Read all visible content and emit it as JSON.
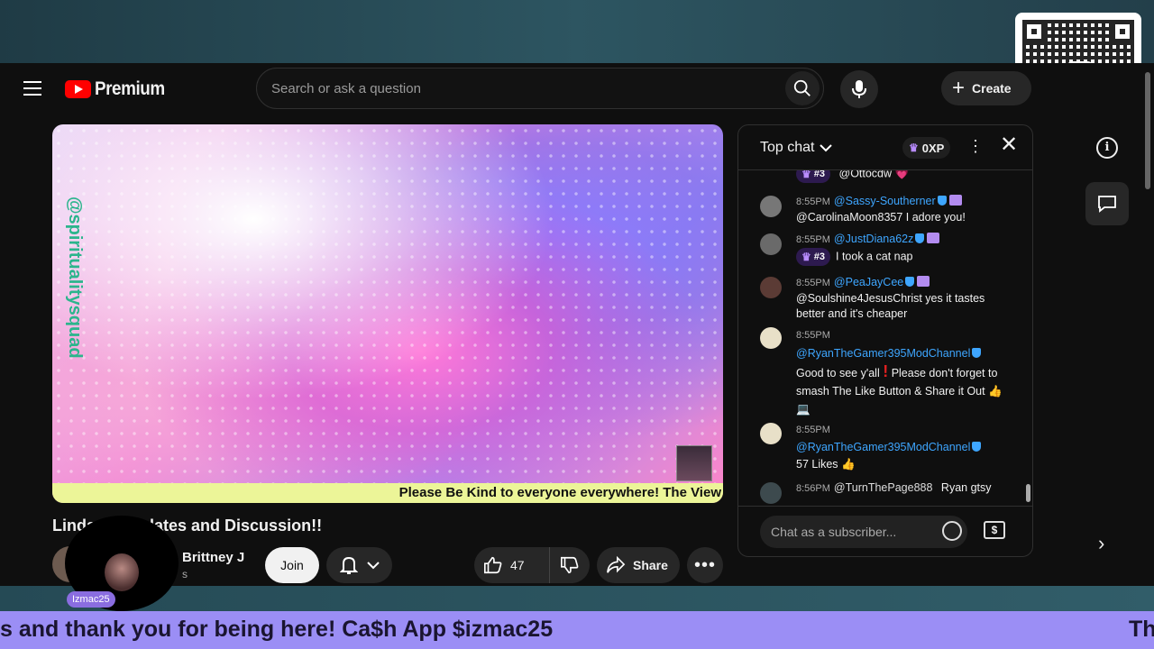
{
  "header": {
    "brand": "Premium",
    "search_placeholder": "Search or ask a question",
    "create_label": "Create"
  },
  "video": {
    "overlay_ticker": "Please Be Kind to everyone everywhere! The View",
    "watermark": "@spiritualitysquad",
    "title": "Linda        cy Updates and Discussion!!",
    "channel_name": "Brittney J",
    "subscriber_fragment": "s",
    "join_label": "Join",
    "like_count": "47",
    "share_label": "Share"
  },
  "webcam": {
    "label": "Izmac25"
  },
  "chat": {
    "header_label": "Top chat",
    "xp_label": "0XP",
    "input_placeholder": "Chat as a subscriber...",
    "messages": [
      {
        "time": "",
        "author": "",
        "rank": "#3",
        "text": "@Ottocdw",
        "emoji": "💗"
      },
      {
        "time": "8:55PM",
        "author": "@Sassy-Southerner",
        "text": "@CarolinaMoon8357 I adore you!"
      },
      {
        "time": "8:55PM",
        "author": "@JustDiana62z",
        "rank": "#3",
        "text": "I took a cat nap"
      },
      {
        "time": "8:55PM",
        "author": "@PeaJayCee",
        "text": "@Soulshine4JesusChrist yes it tastes better and it's cheaper"
      },
      {
        "time": "8:55PM",
        "author": "@RyanTheGamer395ModChannel",
        "text": "Good to see y'all",
        "text2": "Please don't forget to smash The Like Button & Share it Out"
      },
      {
        "time": "8:55PM",
        "author": "@RyanTheGamer395ModChannel",
        "text": "57 Likes"
      },
      {
        "time": "8:56PM",
        "author": "@TurnThePage888",
        "text": "Ryan gtsy"
      }
    ]
  },
  "ticker": {
    "left_text": "s and thank you for being here! Ca$h App $izmac25",
    "right_text": "Th"
  },
  "qr": {
    "icon": "cash-app-icon",
    "symbol": "$"
  },
  "colors": {
    "accent_red": "#ff0000",
    "link_blue": "#3ea6ff",
    "ticker_purple": "#9b8ef5",
    "cash_green": "#00d632"
  }
}
